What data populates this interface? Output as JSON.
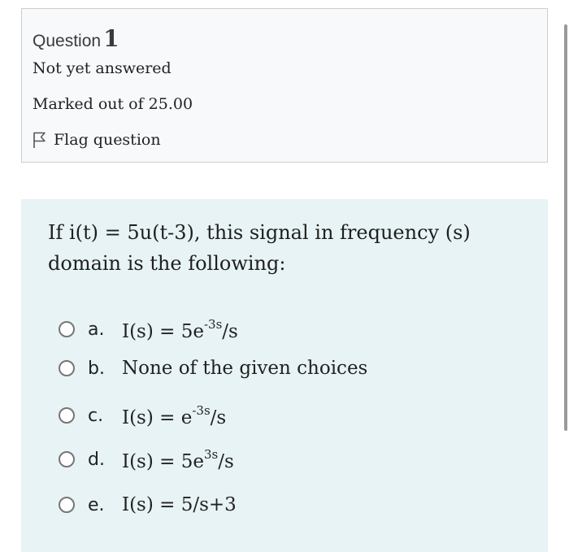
{
  "question_info": {
    "label": "Question",
    "number": "1",
    "status": "Not yet answered",
    "marks": "Marked out of 25.00",
    "flag_label": "Flag question",
    "flag_icon": "flag-outline-icon"
  },
  "question": {
    "text": "If i(t) = 5u(t-3), this signal in frequency (s) domain is the following:",
    "options": [
      {
        "letter": "a.",
        "prefix": "I(s) = 5e",
        "sup": "-3s",
        "suffix": "/s"
      },
      {
        "letter": "b.",
        "prefix": "None of the given choices",
        "sup": "",
        "suffix": ""
      },
      {
        "letter": "c.",
        "prefix": "I(s) = e",
        "sup": "-3s",
        "suffix": "/s"
      },
      {
        "letter": "d.",
        "prefix": "I(s) = 5e",
        "sup": "3s",
        "suffix": "/s"
      },
      {
        "letter": "e.",
        "prefix": "I(s) = 5/s+3",
        "sup": "",
        "suffix": ""
      }
    ]
  },
  "colors": {
    "info_background": "#f8f9fa",
    "content_background": "#e7f3f5",
    "border": "#cfcfcf",
    "text": "#222222"
  }
}
